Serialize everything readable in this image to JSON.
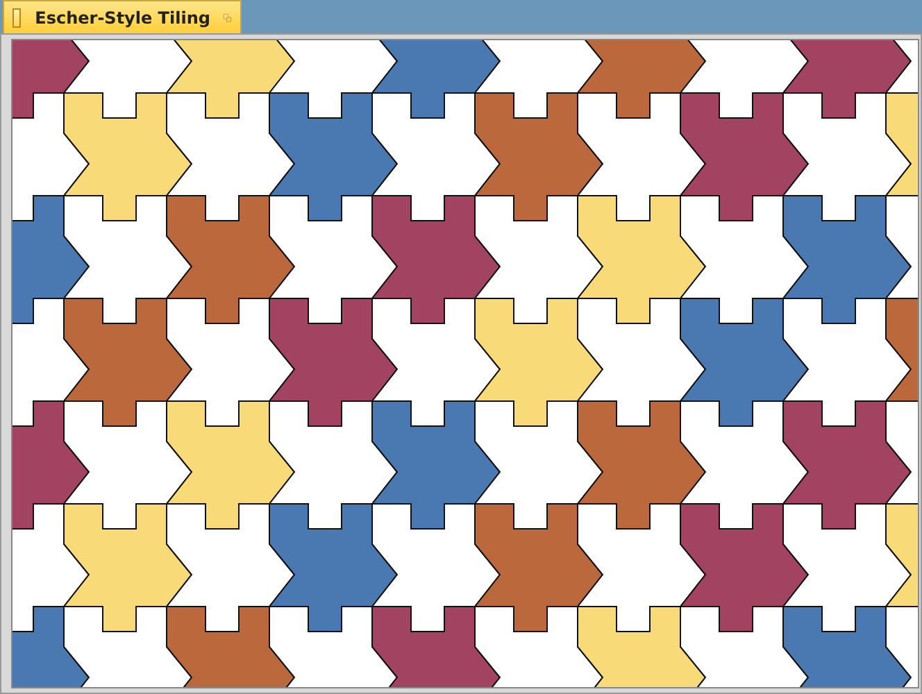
{
  "window": {
    "title": "Escher-Style Tiling"
  }
}
